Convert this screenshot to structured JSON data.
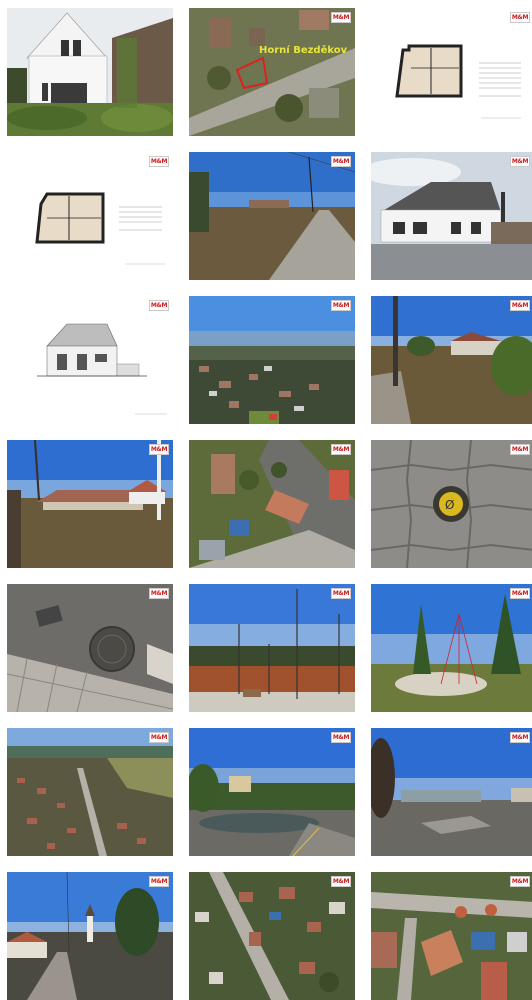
{
  "gallery": {
    "agency_logo_text": "M&M",
    "map_label": "Horní Bezděkov"
  }
}
